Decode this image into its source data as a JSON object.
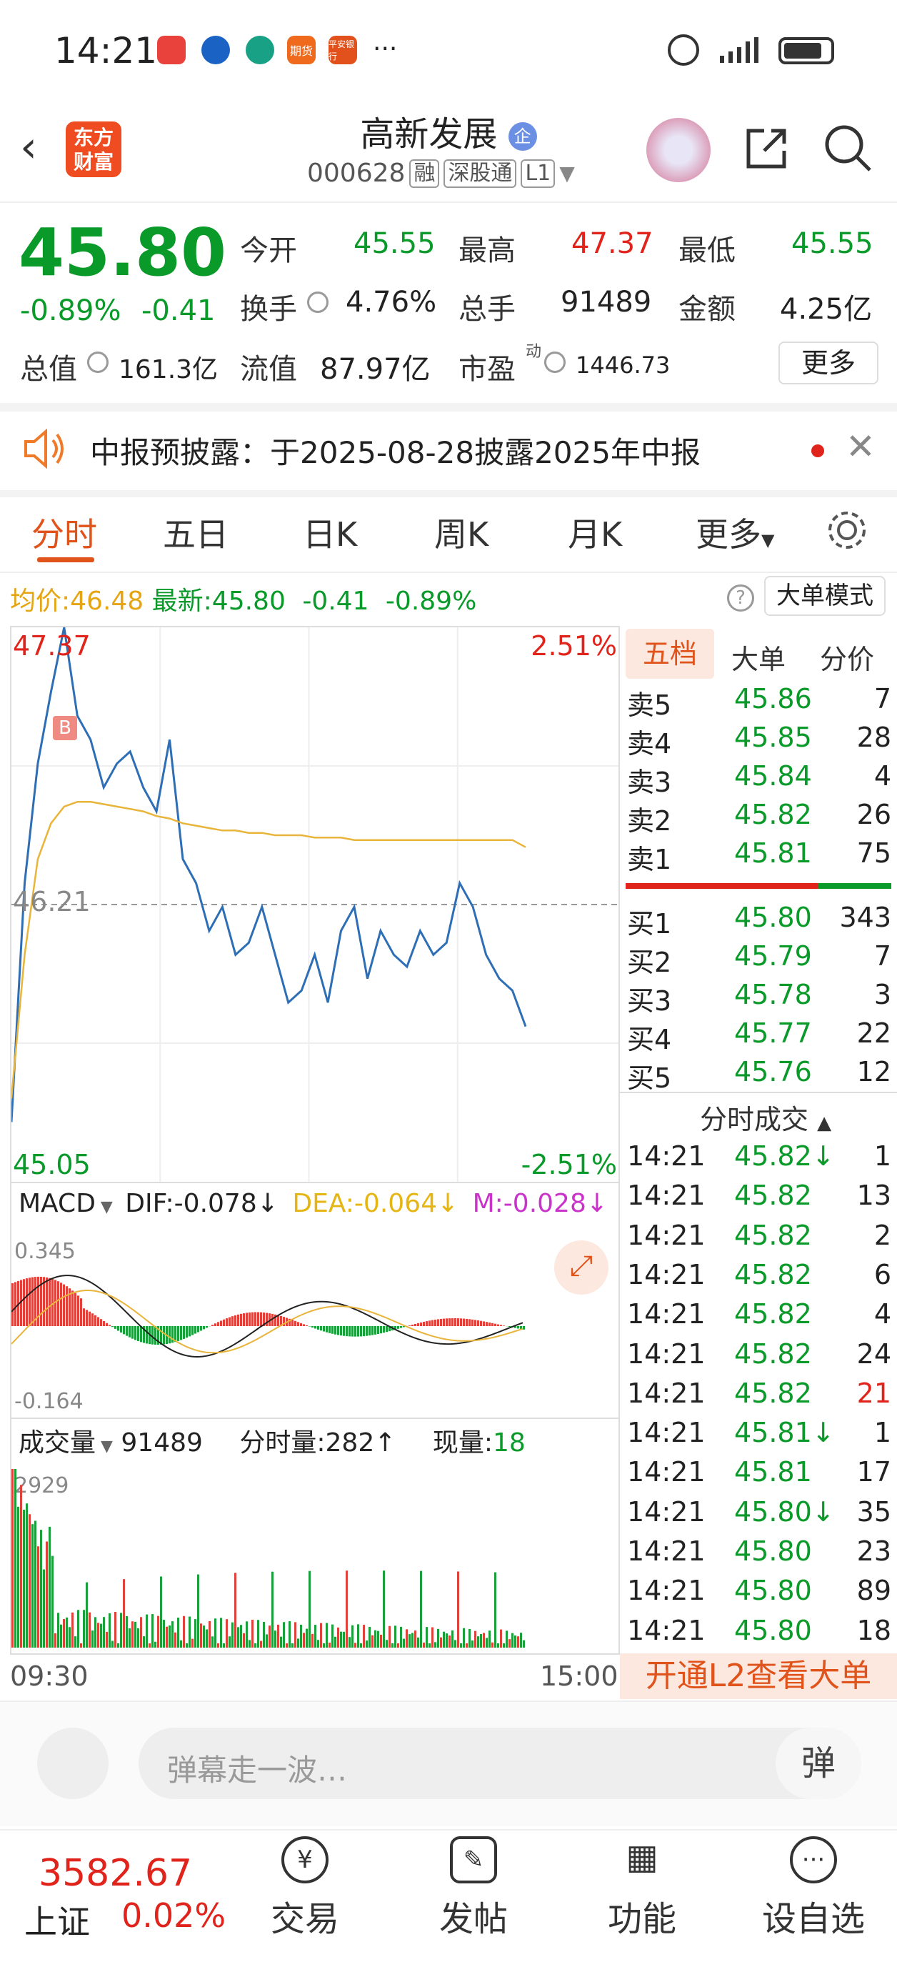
{
  "status": {
    "time": "14:21",
    "apps": [
      "HUAWEI",
      "",
      "",
      "期货",
      "平安银行"
    ],
    "more": "···"
  },
  "nav": {
    "logo": "东方\n财富",
    "name": "高新发展",
    "badge": "企",
    "code": "000628",
    "tags": [
      "融",
      "深股通",
      "L1"
    ]
  },
  "quote": {
    "price": "45.80",
    "pct": "-0.89%",
    "chg": "-0.41",
    "open_label": "今开",
    "open": "45.55",
    "high_label": "最高",
    "high": "47.37",
    "low_label": "最低",
    "low": "45.55",
    "turnover_label": "换手",
    "turnover": "4.76%",
    "vol_label": "总手",
    "vol": "91489",
    "amount_label": "金额",
    "amount": "4.25亿",
    "mcap_label": "总值",
    "mcap": "161.3亿",
    "float_label": "流值",
    "float": "87.97亿",
    "pe_label": "市盈",
    "pe_sup": "动",
    "pe": "1446.73",
    "more": "更多"
  },
  "banner": {
    "text": "中报预披露：于2025-08-28披露2025年中报"
  },
  "tabs": [
    "分时",
    "五日",
    "日K",
    "周K",
    "月K",
    "更多"
  ],
  "infobar": {
    "avg_label": "均价:",
    "avg": "46.48",
    "latest_label": "最新:",
    "latest": "45.80",
    "chg": "-0.41",
    "pct": "-0.89%",
    "mode": "大单模式"
  },
  "chart": {
    "top_price": "47.37",
    "top_pct": "2.51%",
    "mid_price": "46.21",
    "bot_price": "45.05",
    "bot_pct": "-2.51%",
    "start": "09:30",
    "end": "15:00",
    "b_marker": "B",
    "macd_label": "MACD",
    "dif": "DIF:-0.078↓",
    "dea": "DEA:-0.064↓",
    "m": "M:-0.028↓",
    "macd_top": "0.345",
    "macd_bot": "-0.164",
    "vol_label": "成交量",
    "vol_total": "91489",
    "vol_min": "分时量:282↑",
    "vol_now_label": "现量:",
    "vol_now": "18",
    "vol_top": "2929"
  },
  "chart_data": {
    "type": "line",
    "price_axis": [
      45.05,
      47.37
    ],
    "series": [
      {
        "name": "price",
        "values": [
          45.3,
          46.3,
          46.8,
          47.1,
          47.37,
          47.0,
          46.9,
          46.7,
          46.8,
          46.85,
          46.7,
          46.6,
          46.9,
          46.4,
          46.3,
          46.1,
          46.2,
          46.0,
          46.05,
          46.2,
          46.0,
          45.8,
          45.85,
          46.0,
          45.8,
          46.1,
          46.2,
          45.9,
          46.1,
          46.0,
          45.95,
          46.1,
          46.0,
          46.05,
          46.3,
          46.2,
          46.0,
          45.9,
          45.85,
          45.7
        ]
      },
      {
        "name": "avg",
        "values": [
          45.4,
          46.0,
          46.4,
          46.55,
          46.62,
          46.64,
          46.64,
          46.63,
          46.62,
          46.61,
          46.6,
          46.58,
          46.57,
          46.55,
          46.54,
          46.53,
          46.52,
          46.52,
          46.51,
          46.51,
          46.5,
          46.5,
          46.5,
          46.49,
          46.49,
          46.49,
          46.48,
          46.48,
          46.48,
          46.48,
          46.48,
          46.48,
          46.48,
          46.48,
          46.48,
          46.48,
          46.48,
          46.48,
          46.48,
          46.45
        ]
      }
    ]
  },
  "orderbook": {
    "tabs": [
      "五档",
      "大单",
      "分价"
    ],
    "sells": [
      [
        "卖5",
        "45.86",
        "7"
      ],
      [
        "卖4",
        "45.85",
        "28"
      ],
      [
        "卖3",
        "45.84",
        "4"
      ],
      [
        "卖2",
        "45.82",
        "26"
      ],
      [
        "卖1",
        "45.81",
        "75"
      ]
    ],
    "buys": [
      [
        "买1",
        "45.80",
        "343"
      ],
      [
        "买2",
        "45.79",
        "7"
      ],
      [
        "买3",
        "45.78",
        "3"
      ],
      [
        "买4",
        "45.77",
        "22"
      ],
      [
        "买5",
        "45.76",
        "12"
      ]
    ]
  },
  "ticks": {
    "title": "分时成交",
    "rows": [
      [
        "14:21",
        "45.82↓",
        "1"
      ],
      [
        "14:21",
        "45.82",
        "13"
      ],
      [
        "14:21",
        "45.82",
        "2"
      ],
      [
        "14:21",
        "45.82",
        "6"
      ],
      [
        "14:21",
        "45.82",
        "4"
      ],
      [
        "14:21",
        "45.82",
        "24"
      ],
      [
        "14:21",
        "45.82",
        "21"
      ],
      [
        "14:21",
        "45.81↓",
        "1"
      ],
      [
        "14:21",
        "45.81",
        "17"
      ],
      [
        "14:21",
        "45.80↓",
        "35"
      ],
      [
        "14:21",
        "45.80",
        "23"
      ],
      [
        "14:21",
        "45.80",
        "89"
      ],
      [
        "14:21",
        "45.80",
        "18"
      ]
    ],
    "l2": "开通L2查看大单"
  },
  "danmu": {
    "placeholder": "弹幕走一波…",
    "send": "弹"
  },
  "bottom": {
    "index_value": "3582.67",
    "index_name": "上证",
    "index_pct": "0.02%",
    "items": [
      "交易",
      "发帖",
      "功能",
      "设自选"
    ]
  }
}
